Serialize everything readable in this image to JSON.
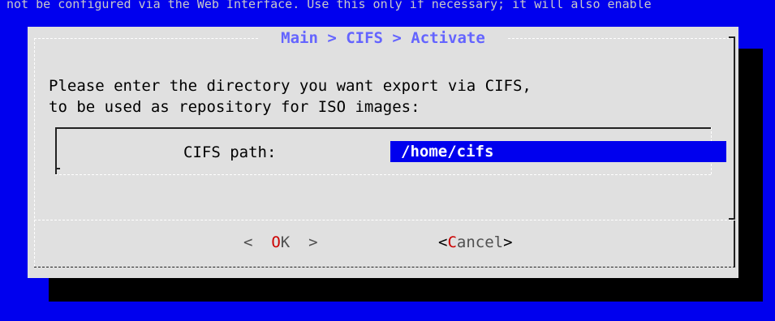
{
  "top_text": "not be configured via the Web Interface. Use this only if necessary; it will also enable",
  "dialog": {
    "title": "Main > CIFS > Activate",
    "prompt_line1": "Please enter the directory you want export via CIFS,",
    "prompt_line2": "to be used as repository for ISO images:",
    "field_label": "CIFS path:",
    "field_value": "/home/cifs"
  },
  "buttons": {
    "ok": {
      "left_bracket": "<",
      "hotkey": "O",
      "rest": "K",
      "right_bracket": ">"
    },
    "cancel": {
      "left_bracket": "<",
      "hotkey": "C",
      "rest": "ancel",
      "right_bracket": ">"
    }
  },
  "colors": {
    "screen_bg": "#0000ee",
    "dialog_bg": "#e0e0e0",
    "title": "#6464ff",
    "hotkey": "#cc0000",
    "input_bg": "#0000ee"
  }
}
